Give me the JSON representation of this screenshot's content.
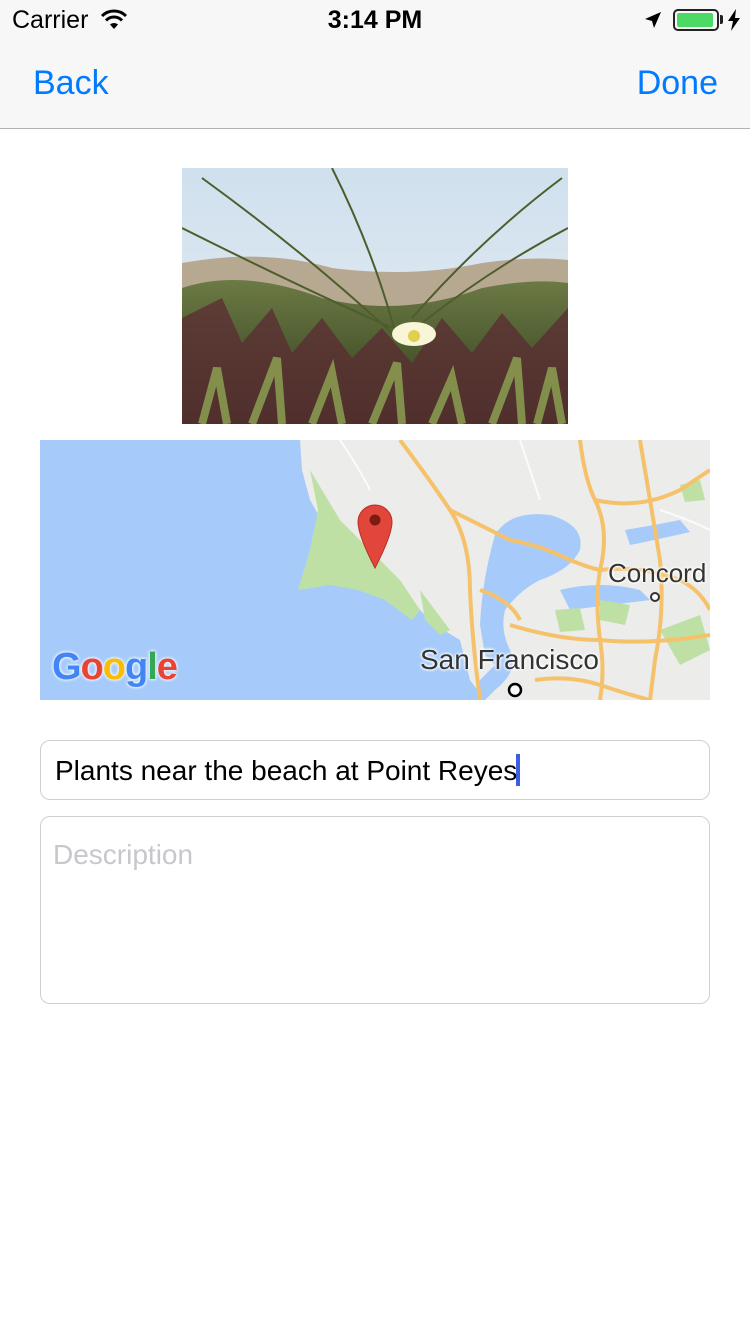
{
  "status_bar": {
    "carrier": "Carrier",
    "time": "3:14 PM",
    "battery_level": 0.95,
    "charging": true
  },
  "nav": {
    "back_label": "Back",
    "done_label": "Done",
    "tint": "#007aff"
  },
  "map": {
    "labels": {
      "concord": "Concord",
      "san_francisco": "San Francisco"
    },
    "attribution": [
      "G",
      "o",
      "o",
      "g",
      "l",
      "e"
    ],
    "attribution_colors": [
      "#4285f4",
      "#ea4335",
      "#fbbc05",
      "#4285f4",
      "#34a853",
      "#ea4335"
    ],
    "pin_icon": "map-pin-icon",
    "pin_color": "#e2463a"
  },
  "form": {
    "title_value": "Plants near the beach at Point Reyes",
    "description_placeholder": "Description",
    "description_value": ""
  }
}
